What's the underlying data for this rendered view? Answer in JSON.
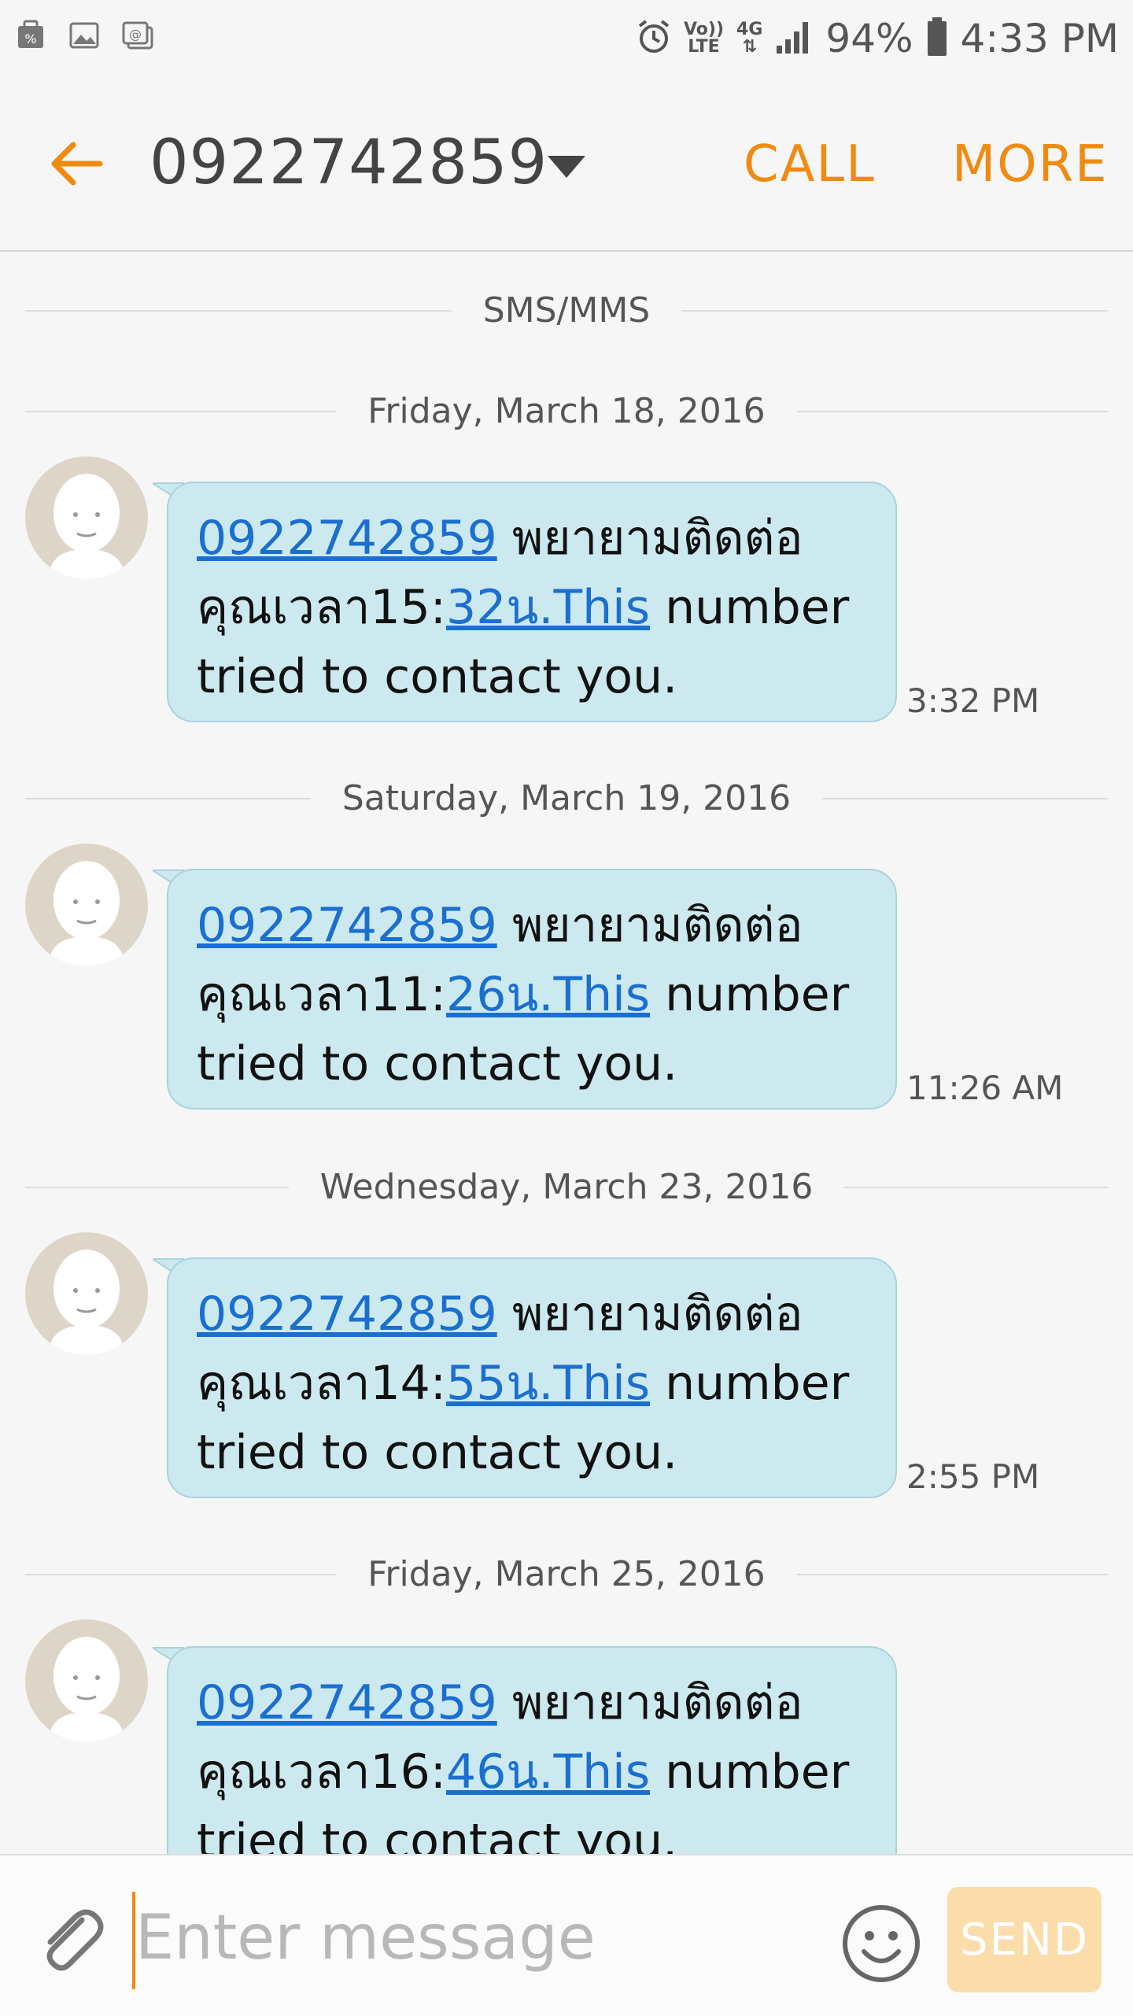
{
  "status_bar": {
    "volte_top": "Vo))",
    "volte_bottom": "LTE",
    "network": "4G",
    "battery": "94%",
    "time": "4:33 PM"
  },
  "header": {
    "title": "0922742859",
    "call_label": "CALL",
    "more_label": "MORE",
    "accent_color": "#f08a10"
  },
  "feed": {
    "channel_label": "SMS/MMS",
    "messages": [
      {
        "date": "Friday, March 18, 2016",
        "number": "0922742859",
        "thai1": "พยายามติดต่อ",
        "thai2": "คุณเวลา15:",
        "link": "32น.This",
        "rest1": "number",
        "rest2": "tried to contact you.",
        "time": "3:32 PM"
      },
      {
        "date": "Saturday, March 19, 2016",
        "number": "0922742859",
        "thai1": "พยายามติดต่อ",
        "thai2": "คุณเวลา11:",
        "link": "26น.This",
        "rest1": "number",
        "rest2": "tried to contact you.",
        "time": "11:26 AM"
      },
      {
        "date": "Wednesday, March 23, 2016",
        "number": "0922742859",
        "thai1": "พยายามติดต่อ",
        "thai2": "คุณเวลา14:",
        "link": "55น.This",
        "rest1": "number",
        "rest2": "tried to contact you.",
        "time": "2:55 PM"
      },
      {
        "date": "Friday, March 25, 2016",
        "number": "0922742859",
        "thai1": "พยายามติดต่อ",
        "thai2": "คุณเวลา16:",
        "link": "46น.This",
        "rest1": "number",
        "rest2": "tried to contact you.",
        "time": ""
      }
    ]
  },
  "composer": {
    "placeholder": "Enter message",
    "send_label": "SEND"
  }
}
